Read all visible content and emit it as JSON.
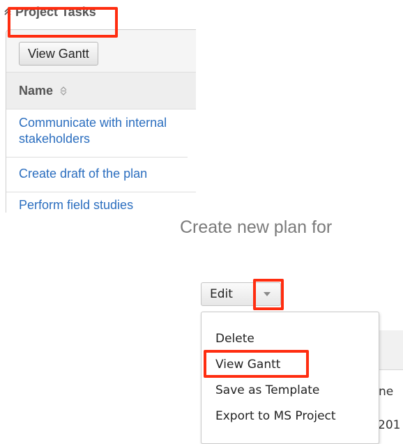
{
  "subpanel": {
    "title": "Project Tasks",
    "collapse_icon": "double-chevron-up-icon"
  },
  "toolbar": {
    "view_gantt_label": "View Gantt"
  },
  "table": {
    "column_header": "Name",
    "sort_icon": "sort-up-down-icon",
    "rows": [
      "Communicate with internal stakeholders",
      "Create draft of the plan",
      "Perform field studies"
    ]
  },
  "plan": {
    "title": "Create new plan for"
  },
  "action_menu": {
    "edit_label": "Edit",
    "caret_icon": "caret-down-icon",
    "items": [
      "Delete",
      "View Gantt",
      "Save as Template",
      "Export to MS Project"
    ]
  },
  "background_fragments": {
    "text_1": "ne",
    "text_2": "201"
  },
  "colors": {
    "highlight": "#ff2d10",
    "link": "#2b6ebf"
  }
}
